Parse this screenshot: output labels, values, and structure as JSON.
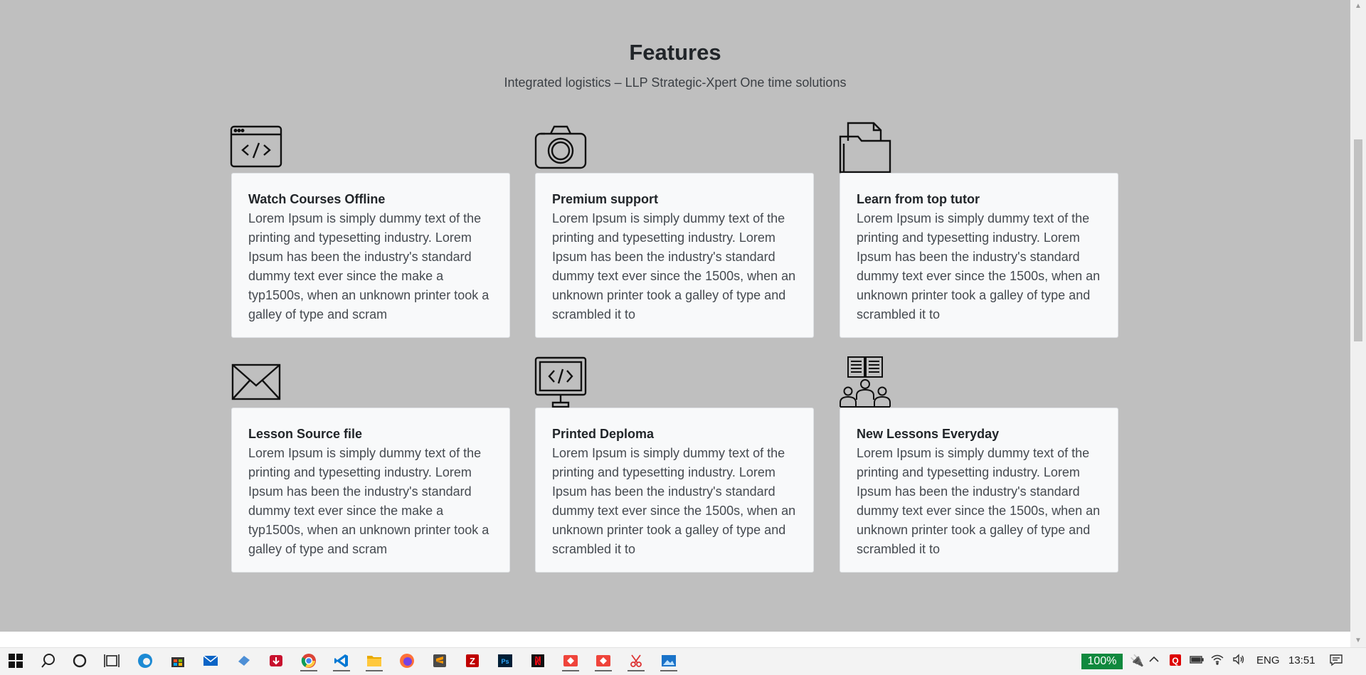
{
  "features": {
    "title": "Features",
    "subtitle": "Integrated logistics – LLP Strategic-Xpert One time solutions",
    "items": [
      {
        "icon": "code-window-icon",
        "title": "Watch Courses Offline",
        "text": "Lorem Ipsum is simply dummy text of the printing and typesetting industry. Lorem Ipsum has been the industry's standard dummy text ever since the make a typ1500s, when an unknown printer took a galley of type and scram"
      },
      {
        "icon": "camera-icon",
        "title": "Premium support",
        "text": "Lorem Ipsum is simply dummy text of the printing and typesetting industry. Lorem Ipsum has been the industry's standard dummy text ever since the 1500s, when an unknown printer took a galley of type and scrambled it to"
      },
      {
        "icon": "folder-icon",
        "title": "Learn from top tutor",
        "text": "Lorem Ipsum is simply dummy text of the printing and typesetting industry. Lorem Ipsum has been the industry's standard dummy text ever since the 1500s, when an unknown printer took a galley of type and scrambled it to"
      },
      {
        "icon": "envelope-icon",
        "title": "Lesson Source file",
        "text": "Lorem Ipsum is simply dummy text of the printing and typesetting industry. Lorem Ipsum has been the industry's standard dummy text ever since the make a typ1500s, when an unknown printer took a galley of type and scram"
      },
      {
        "icon": "monitor-code-icon",
        "title": "Printed Deploma",
        "text": "Lorem Ipsum is simply dummy text of the printing and typesetting industry. Lorem Ipsum has been the industry's standard dummy text ever since the 1500s, when an unknown printer took a galley of type and scrambled it to"
      },
      {
        "icon": "book-group-icon",
        "title": "New Lessons Everyday",
        "text": "Lorem Ipsum is simply dummy text of the printing and typesetting industry. Lorem Ipsum has been the industry's standard dummy text ever since the 1500s, when an unknown printer took a galley of type and scrambled it to"
      }
    ]
  },
  "taskbar": {
    "apps": [
      "start-icon",
      "search-icon",
      "cortana-icon",
      "task-view-icon",
      "edge-icon",
      "store-icon",
      "mail-icon",
      "app-icon",
      "download-icon",
      "chrome-icon",
      "vscode-icon",
      "file-explorer-icon",
      "firefox-icon",
      "sublime-icon",
      "filezilla-icon",
      "photoshop-icon",
      "netflix-icon",
      "anydesk-icon",
      "anydesk-icon",
      "snipping-icon",
      "photos-icon"
    ],
    "battery_percent": "100%",
    "language": "ENG",
    "time": "13:51"
  },
  "colors": {
    "page_background": "#bfbfbf",
    "card_background": "#f8f9fa",
    "battery_badge": "#10893e"
  }
}
